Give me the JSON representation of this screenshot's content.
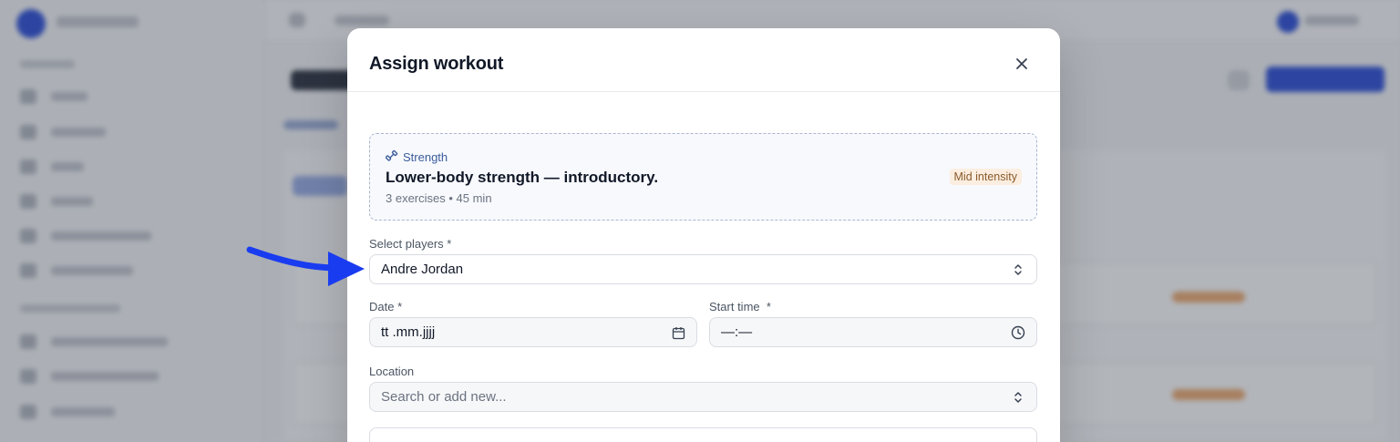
{
  "modal": {
    "title": "Assign workout",
    "close_icon": "close-icon"
  },
  "workout": {
    "category_icon": "dumbbell-icon",
    "category": "Strength",
    "title": "Lower-body strength — introductory.",
    "meta": "3 exercises • 45 min",
    "intensity": "Mid intensity"
  },
  "form": {
    "players_label": "Select players *",
    "players_value": "Andre Jordan",
    "date_label": "Date *",
    "date_value": "tt .mm.jjjj",
    "time_label": "Start time  *",
    "time_value": "—:—",
    "location_label": "Location",
    "location_placeholder": "Search or add new..."
  },
  "colors": {
    "arrow": "#1a3cf0",
    "accent": "#3b5bdb",
    "badge_bg": "#fbeee0"
  }
}
